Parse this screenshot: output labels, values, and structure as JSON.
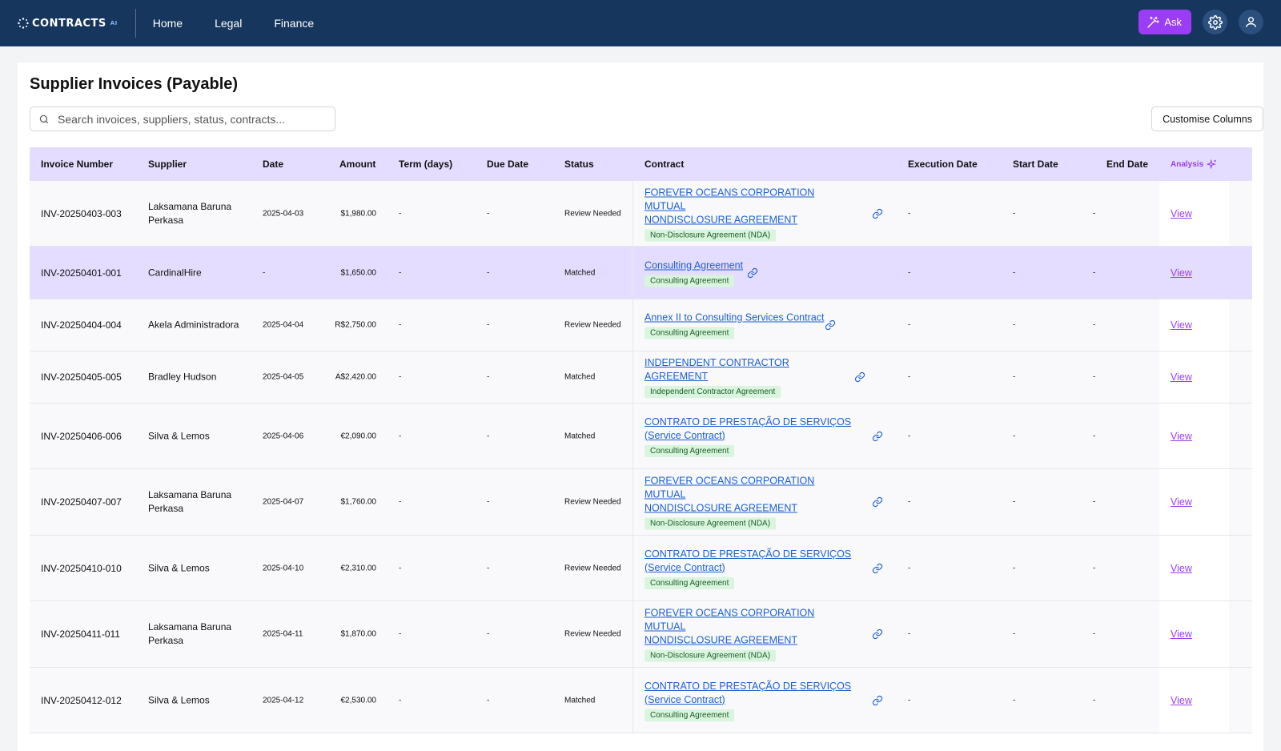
{
  "app": {
    "logo_text": "CONTRACTS",
    "logo_suffix": "AI"
  },
  "nav": {
    "items": [
      "Home",
      "Legal",
      "Finance"
    ]
  },
  "header": {
    "ask_label": "Ask"
  },
  "page": {
    "title": "Supplier Invoices (Payable)",
    "search_placeholder": "Search invoices, suppliers, status, contracts...",
    "customise_label": "Customise Columns"
  },
  "table": {
    "columns": {
      "invoice_number": "Invoice Number",
      "supplier": "Supplier",
      "date": "Date",
      "amount": "Amount",
      "term": "Term (days)",
      "due_date": "Due Date",
      "status": "Status",
      "contract": "Contract",
      "execution_date": "Execution Date",
      "start_date": "Start Date",
      "end_date": "End Date",
      "analysis": "Analysis"
    },
    "rows": [
      {
        "invoice": "INV-20250403-003",
        "supplier_l1": "Laksamana Baruna",
        "supplier_l2": "Perkasa",
        "date": "2025-04-03",
        "amount": "$1,980.00",
        "term": "-",
        "due": "-",
        "status": "Review Needed",
        "contract_l1": "FOREVER OCEANS CORPORATION MUTUAL",
        "contract_l2": "NONDISCLOSURE AGREEMENT",
        "tag": "Non-Disclosure Agreement (NDA)",
        "exec": "-",
        "start": "-",
        "end": "-",
        "action": "View"
      },
      {
        "invoice": "INV-20250401-001",
        "supplier_l1": "CardinalHire",
        "supplier_l2": "",
        "date": "-",
        "amount": "$1,650.00",
        "term": "-",
        "due": "-",
        "status": "Matched",
        "contract_l1": "Consulting Agreement",
        "contract_l2": "",
        "tag": "Consulting Agreement",
        "exec": "-",
        "start": "-",
        "end": "-",
        "action": "View"
      },
      {
        "invoice": "INV-20250404-004",
        "supplier_l1": "Akela Administradora",
        "supplier_l2": "",
        "date": "2025-04-04",
        "amount": "R$2,750.00",
        "term": "-",
        "due": "-",
        "status": "Review Needed",
        "contract_l1": "Annex II to Consulting Services Contract",
        "contract_l2": "",
        "tag": "Consulting Agreement",
        "exec": "-",
        "start": "-",
        "end": "-",
        "action": "View"
      },
      {
        "invoice": "INV-20250405-005",
        "supplier_l1": "Bradley Hudson",
        "supplier_l2": "",
        "date": "2025-04-05",
        "amount": "A$2,420.00",
        "term": "-",
        "due": "-",
        "status": "Matched",
        "contract_l1": "INDEPENDENT CONTRACTOR AGREEMENT",
        "contract_l2": "",
        "tag": "Independent Contractor Agreement",
        "exec": "-",
        "start": "-",
        "end": "-",
        "action": "View"
      },
      {
        "invoice": "INV-20250406-006",
        "supplier_l1": "Silva & Lemos",
        "supplier_l2": "",
        "date": "2025-04-06",
        "amount": "€2,090.00",
        "term": "-",
        "due": "-",
        "status": "Matched",
        "contract_l1": "CONTRATO DE PRESTAÇÃO DE SERVIÇOS",
        "contract_l2": "(Service Contract)",
        "tag": "Consulting Agreement",
        "exec": "-",
        "start": "-",
        "end": "-",
        "action": "View"
      },
      {
        "invoice": "INV-20250407-007",
        "supplier_l1": "Laksamana Baruna",
        "supplier_l2": "Perkasa",
        "date": "2025-04-07",
        "amount": "$1,760.00",
        "term": "-",
        "due": "-",
        "status": "Review Needed",
        "contract_l1": "FOREVER OCEANS CORPORATION MUTUAL",
        "contract_l2": "NONDISCLOSURE AGREEMENT",
        "tag": "Non-Disclosure Agreement (NDA)",
        "exec": "-",
        "start": "-",
        "end": "-",
        "action": "View"
      },
      {
        "invoice": "INV-20250410-010",
        "supplier_l1": "Silva & Lemos",
        "supplier_l2": "",
        "date": "2025-04-10",
        "amount": "€2,310.00",
        "term": "-",
        "due": "-",
        "status": "Review Needed",
        "contract_l1": "CONTRATO DE PRESTAÇÃO DE SERVIÇOS",
        "contract_l2": "(Service Contract)",
        "tag": "Consulting Agreement",
        "exec": "-",
        "start": "-",
        "end": "-",
        "action": "View"
      },
      {
        "invoice": "INV-20250411-011",
        "supplier_l1": "Laksamana Baruna",
        "supplier_l2": "Perkasa",
        "date": "2025-04-11",
        "amount": "$1,870.00",
        "term": "-",
        "due": "-",
        "status": "Review Needed",
        "contract_l1": "FOREVER OCEANS CORPORATION MUTUAL",
        "contract_l2": "NONDISCLOSURE AGREEMENT",
        "tag": "Non-Disclosure Agreement (NDA)",
        "exec": "-",
        "start": "-",
        "end": "-",
        "action": "View"
      },
      {
        "invoice": "INV-20250412-012",
        "supplier_l1": "Silva & Lemos",
        "supplier_l2": "",
        "date": "2025-04-12",
        "amount": "€2,530.00",
        "term": "-",
        "due": "-",
        "status": "Matched",
        "contract_l1": "CONTRATO DE PRESTAÇÃO DE SERVIÇOS",
        "contract_l2": "(Service Contract)",
        "tag": "Consulting Agreement",
        "exec": "-",
        "start": "-",
        "end": "-",
        "action": "View"
      }
    ]
  },
  "colors": {
    "topbar": "#17365d",
    "accent": "#9b3df5",
    "header_row": "#e4ddff",
    "link": "#1a5fd1",
    "tag_bg": "#d9f5dd"
  }
}
